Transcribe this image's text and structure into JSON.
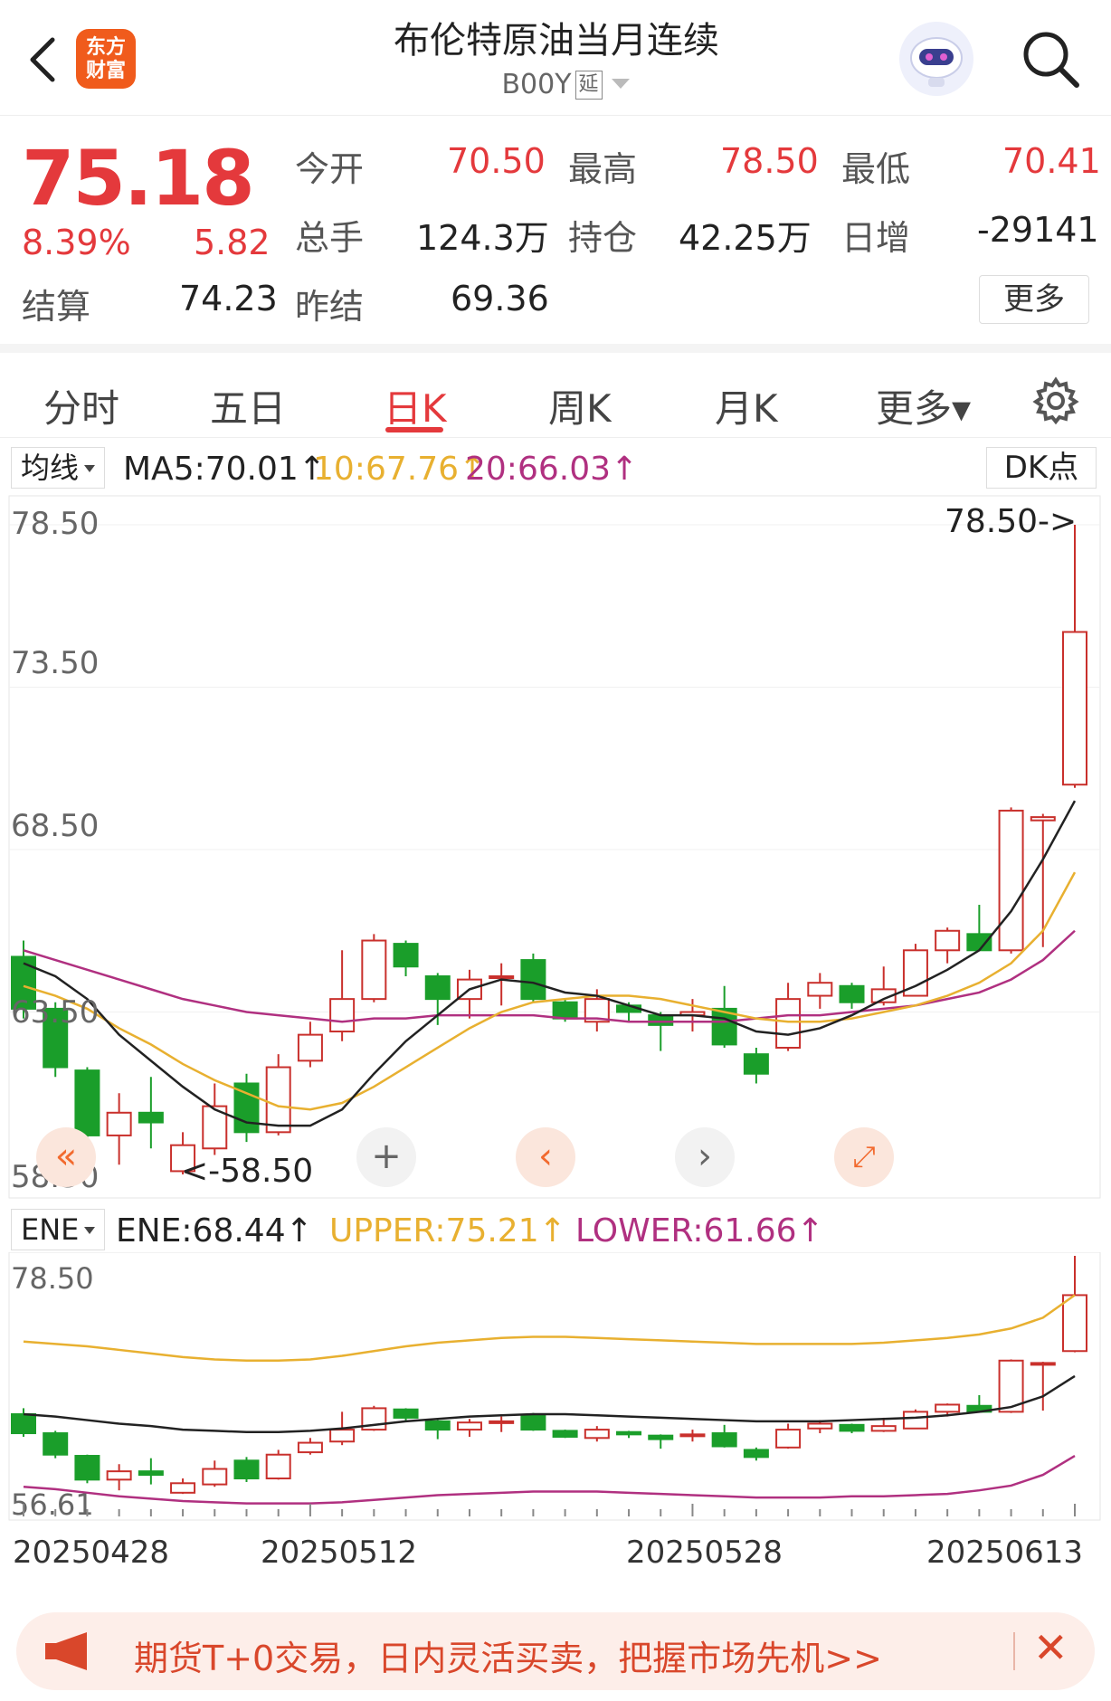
{
  "header": {
    "logo_line1": "东方",
    "logo_line2": "财富",
    "title": "布伦特原油当月连续",
    "code": "B00Y",
    "code_tag": "延"
  },
  "quote": {
    "price": "75.18",
    "change_pct": "8.39%",
    "change": "5.82",
    "settle_label": "结算",
    "settle": "74.23",
    "open_label": "今开",
    "open": "70.50",
    "high_label": "最高",
    "high": "78.50",
    "low_label": "最低",
    "low": "70.41",
    "volume_label": "总手",
    "volume": "124.3万",
    "oi_label": "持仓",
    "oi": "42.25万",
    "daily_inc_label": "日增",
    "daily_inc": "-29141",
    "prev_settle_label": "昨结",
    "prev_settle": "69.36",
    "more_label": "更多"
  },
  "tabs": [
    {
      "label": "分时"
    },
    {
      "label": "五日"
    },
    {
      "label": "日K"
    },
    {
      "label": "周K"
    },
    {
      "label": "月K"
    },
    {
      "label": "更多▾"
    }
  ],
  "ma_row": {
    "selector": "均线",
    "ma5": "MA5:70.01↑",
    "ma10": "10:67.76↑",
    "ma20": "20:66.03↑",
    "dk": "DK点"
  },
  "ene_row": {
    "selector": "ENE",
    "ene": "ENE:68.44↑",
    "upper": "UPPER:75.21↑",
    "lower": "LOWER:61.66↑"
  },
  "chart_labels": {
    "y1": "78.50",
    "y2": "73.50",
    "y3": "68.50",
    "y4": "63.50",
    "y5": "58.50",
    "max_marker": "78.50->",
    "min_marker": "<-58.50",
    "ene_top": "78.50",
    "ene_bottom": "56.61"
  },
  "dates": [
    "20250428",
    "20250512",
    "20250528",
    "20250613"
  ],
  "banner": {
    "text": "期货T+0交易，日内灵活买卖，把握市场先机>>"
  },
  "colors": {
    "up": "#c9302c",
    "down": "#1a9e2a",
    "ma5": "#222222",
    "ma10": "#e8b030",
    "ma20": "#b03080",
    "accent": "#e4393c"
  },
  "chart_data": {
    "type": "candlestick",
    "ylim": [
      58.5,
      78.5
    ],
    "candles": [
      {
        "o": 65.2,
        "c": 63.6,
        "h": 65.7,
        "l": 63.3
      },
      {
        "o": 63.6,
        "c": 61.8,
        "h": 63.8,
        "l": 61.5
      },
      {
        "o": 61.7,
        "c": 59.7,
        "h": 61.8,
        "l": 59.4
      },
      {
        "o": 59.7,
        "c": 60.4,
        "h": 61.0,
        "l": 58.8
      },
      {
        "o": 60.4,
        "c": 60.1,
        "h": 61.5,
        "l": 59.3
      },
      {
        "o": 58.6,
        "c": 59.4,
        "h": 59.8,
        "l": 58.5
      },
      {
        "o": 59.3,
        "c": 60.6,
        "h": 61.3,
        "l": 59.1
      },
      {
        "o": 61.3,
        "c": 59.8,
        "h": 61.6,
        "l": 59.5
      },
      {
        "o": 59.8,
        "c": 61.8,
        "h": 62.2,
        "l": 59.7
      },
      {
        "o": 62.0,
        "c": 62.8,
        "h": 63.2,
        "l": 61.8
      },
      {
        "o": 62.9,
        "c": 63.9,
        "h": 65.4,
        "l": 62.6
      },
      {
        "o": 63.9,
        "c": 65.7,
        "h": 65.9,
        "l": 63.8
      },
      {
        "o": 65.6,
        "c": 64.9,
        "h": 65.7,
        "l": 64.6
      },
      {
        "o": 64.6,
        "c": 63.9,
        "h": 64.7,
        "l": 63.1
      },
      {
        "o": 63.9,
        "c": 64.5,
        "h": 64.8,
        "l": 63.3
      },
      {
        "o": 64.6,
        "c": 64.6,
        "h": 65.0,
        "l": 63.7
      },
      {
        "o": 65.1,
        "c": 63.9,
        "h": 65.3,
        "l": 63.8
      },
      {
        "o": 63.8,
        "c": 63.3,
        "h": 63.9,
        "l": 63.2
      },
      {
        "o": 63.2,
        "c": 63.9,
        "h": 64.2,
        "l": 62.9
      },
      {
        "o": 63.7,
        "c": 63.5,
        "h": 63.8,
        "l": 63.2
      },
      {
        "o": 63.4,
        "c": 63.1,
        "h": 63.5,
        "l": 62.3
      },
      {
        "o": 63.4,
        "c": 63.5,
        "h": 63.9,
        "l": 62.9
      },
      {
        "o": 63.6,
        "c": 62.5,
        "h": 64.3,
        "l": 62.4
      },
      {
        "o": 62.2,
        "c": 61.6,
        "h": 62.4,
        "l": 61.3
      },
      {
        "o": 62.4,
        "c": 63.9,
        "h": 64.4,
        "l": 62.3
      },
      {
        "o": 64.0,
        "c": 64.4,
        "h": 64.7,
        "l": 63.6
      },
      {
        "o": 64.3,
        "c": 63.8,
        "h": 64.4,
        "l": 63.6
      },
      {
        "o": 63.8,
        "c": 64.2,
        "h": 64.9,
        "l": 63.7
      },
      {
        "o": 64.0,
        "c": 65.4,
        "h": 65.6,
        "l": 64.0
      },
      {
        "o": 65.4,
        "c": 66.0,
        "h": 66.1,
        "l": 65.0
      },
      {
        "o": 65.9,
        "c": 65.4,
        "h": 66.8,
        "l": 65.4
      },
      {
        "o": 65.4,
        "c": 69.7,
        "h": 69.8,
        "l": 65.3
      },
      {
        "o": 69.4,
        "c": 69.5,
        "h": 69.6,
        "l": 65.5
      },
      {
        "o": 70.5,
        "c": 75.2,
        "h": 78.5,
        "l": 70.4
      }
    ],
    "ma5": [
      65.0,
      64.6,
      63.9,
      62.8,
      62.0,
      61.2,
      60.5,
      60.1,
      60.0,
      60.0,
      60.5,
      61.6,
      62.6,
      63.4,
      64.2,
      64.5,
      64.4,
      64.1,
      64.0,
      63.7,
      63.4,
      63.4,
      63.3,
      62.9,
      62.8,
      63.0,
      63.4,
      63.9,
      64.3,
      64.8,
      65.4,
      66.6,
      68.2,
      70.0
    ],
    "ma10": [
      64.3,
      64.0,
      63.6,
      63.0,
      62.5,
      61.9,
      61.4,
      61.0,
      60.6,
      60.5,
      60.7,
      61.2,
      61.8,
      62.4,
      63.0,
      63.5,
      63.8,
      63.9,
      64.0,
      64.0,
      63.9,
      63.7,
      63.5,
      63.3,
      63.2,
      63.2,
      63.3,
      63.5,
      63.7,
      64.0,
      64.4,
      65.0,
      66.0,
      67.8
    ],
    "ma20": [
      65.4,
      65.1,
      64.8,
      64.5,
      64.2,
      63.9,
      63.7,
      63.5,
      63.4,
      63.3,
      63.2,
      63.3,
      63.3,
      63.4,
      63.4,
      63.4,
      63.4,
      63.3,
      63.3,
      63.2,
      63.2,
      63.2,
      63.2,
      63.3,
      63.4,
      63.4,
      63.5,
      63.6,
      63.7,
      63.9,
      64.1,
      64.5,
      65.1,
      66.0
    ],
    "ene": {
      "ylim": [
        56.61,
        78.5
      ],
      "upper": [
        71.3,
        71.1,
        70.9,
        70.6,
        70.3,
        70.0,
        69.8,
        69.7,
        69.7,
        69.8,
        70.1,
        70.5,
        70.9,
        71.2,
        71.4,
        71.6,
        71.7,
        71.7,
        71.6,
        71.5,
        71.4,
        71.3,
        71.2,
        71.1,
        71.1,
        71.1,
        71.1,
        71.2,
        71.4,
        71.6,
        71.9,
        72.4,
        73.3,
        75.2
      ],
      "lower": [
        59.1,
        58.9,
        58.6,
        58.3,
        58.1,
        57.9,
        57.8,
        57.7,
        57.7,
        57.7,
        57.8,
        58.0,
        58.2,
        58.4,
        58.5,
        58.6,
        58.7,
        58.7,
        58.7,
        58.6,
        58.5,
        58.4,
        58.3,
        58.2,
        58.2,
        58.2,
        58.3,
        58.3,
        58.4,
        58.5,
        58.8,
        59.2,
        60.1,
        61.7
      ],
      "mid": [
        65.2,
        65.0,
        64.7,
        64.4,
        64.2,
        63.9,
        63.8,
        63.7,
        63.7,
        63.8,
        64.0,
        64.3,
        64.6,
        64.8,
        65.0,
        65.1,
        65.2,
        65.2,
        65.1,
        65.0,
        64.9,
        64.8,
        64.7,
        64.6,
        64.6,
        64.6,
        64.7,
        64.8,
        64.9,
        65.1,
        65.4,
        65.8,
        66.7,
        68.4
      ]
    }
  }
}
